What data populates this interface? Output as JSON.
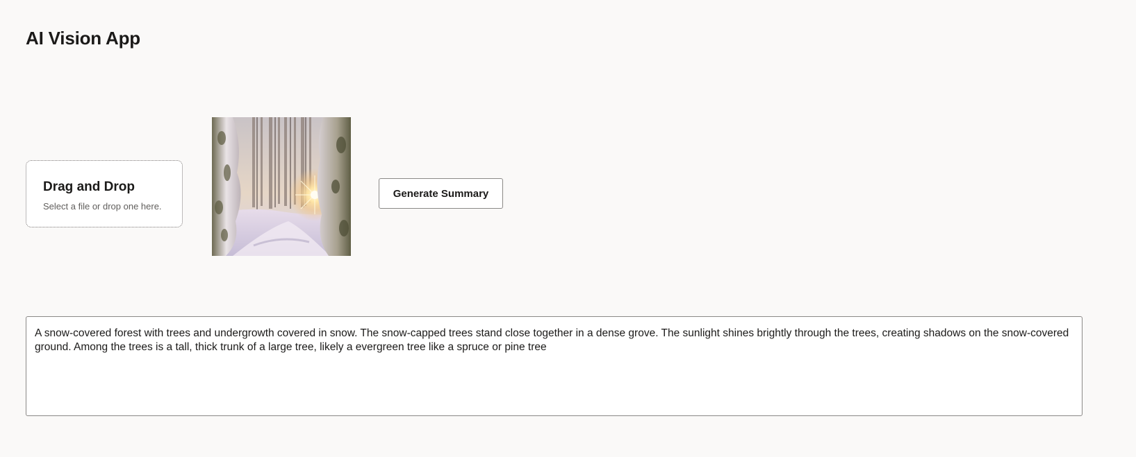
{
  "app": {
    "title": "AI Vision App"
  },
  "upload": {
    "title": "Drag and Drop",
    "hint": "Select a file or drop one here."
  },
  "preview": {
    "image_description": "snow-covered forest with sun shining through trees"
  },
  "actions": {
    "generate_label": "Generate Summary"
  },
  "summary": {
    "text": "A snow-covered forest with trees and undergrowth covered in snow. The snow-capped trees stand close together in a dense grove. The sunlight shines brightly through the trees, creating shadows on the snow-covered ground. Among the trees is a tall, thick trunk of a large tree, likely a evergreen tree like a spruce or pine tree"
  },
  "colors": {
    "background": "#faf9f8",
    "text": "#1b1a19",
    "border": "#8a8886",
    "hint": "#605e5c"
  }
}
